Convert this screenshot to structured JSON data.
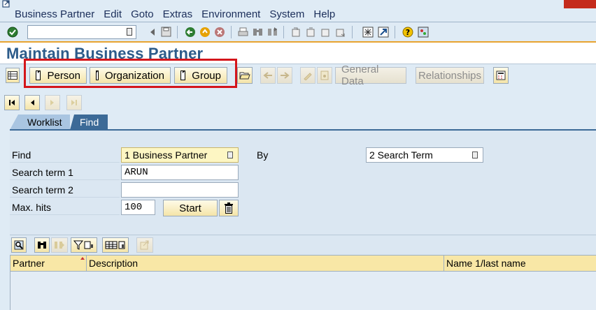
{
  "menu": {
    "items": [
      "Business Partner",
      "Edit",
      "Goto",
      "Extras",
      "Environment",
      "System",
      "Help"
    ]
  },
  "toolbar": {
    "command_value": ""
  },
  "page": {
    "title": "Maintain Business Partner"
  },
  "app_toolbar": {
    "person": "Person",
    "organization": "Organization",
    "group": "Group",
    "general_data": "General Data",
    "relationships": "Relationships"
  },
  "tabs": {
    "worklist": "Worklist",
    "find": "Find"
  },
  "form": {
    "find_label": "Find",
    "find_value": "1 Business Partner",
    "by_label": "By",
    "by_value": "2 Search Term",
    "search_term1_label": "Search term 1",
    "search_term1_value": "ARUN",
    "search_term2_label": "Search term 2",
    "search_term2_value": "",
    "max_hits_label": "Max. hits",
    "max_hits_value": "100",
    "start_label": "Start"
  },
  "grid": {
    "columns": [
      "Partner",
      "Description",
      "Name 1/last name"
    ]
  },
  "colors": {
    "title": "#2c5b8a",
    "highlight_box": "#d4151b",
    "active_tab": "#3c6a97",
    "grid_header": "#f8e7a6"
  }
}
